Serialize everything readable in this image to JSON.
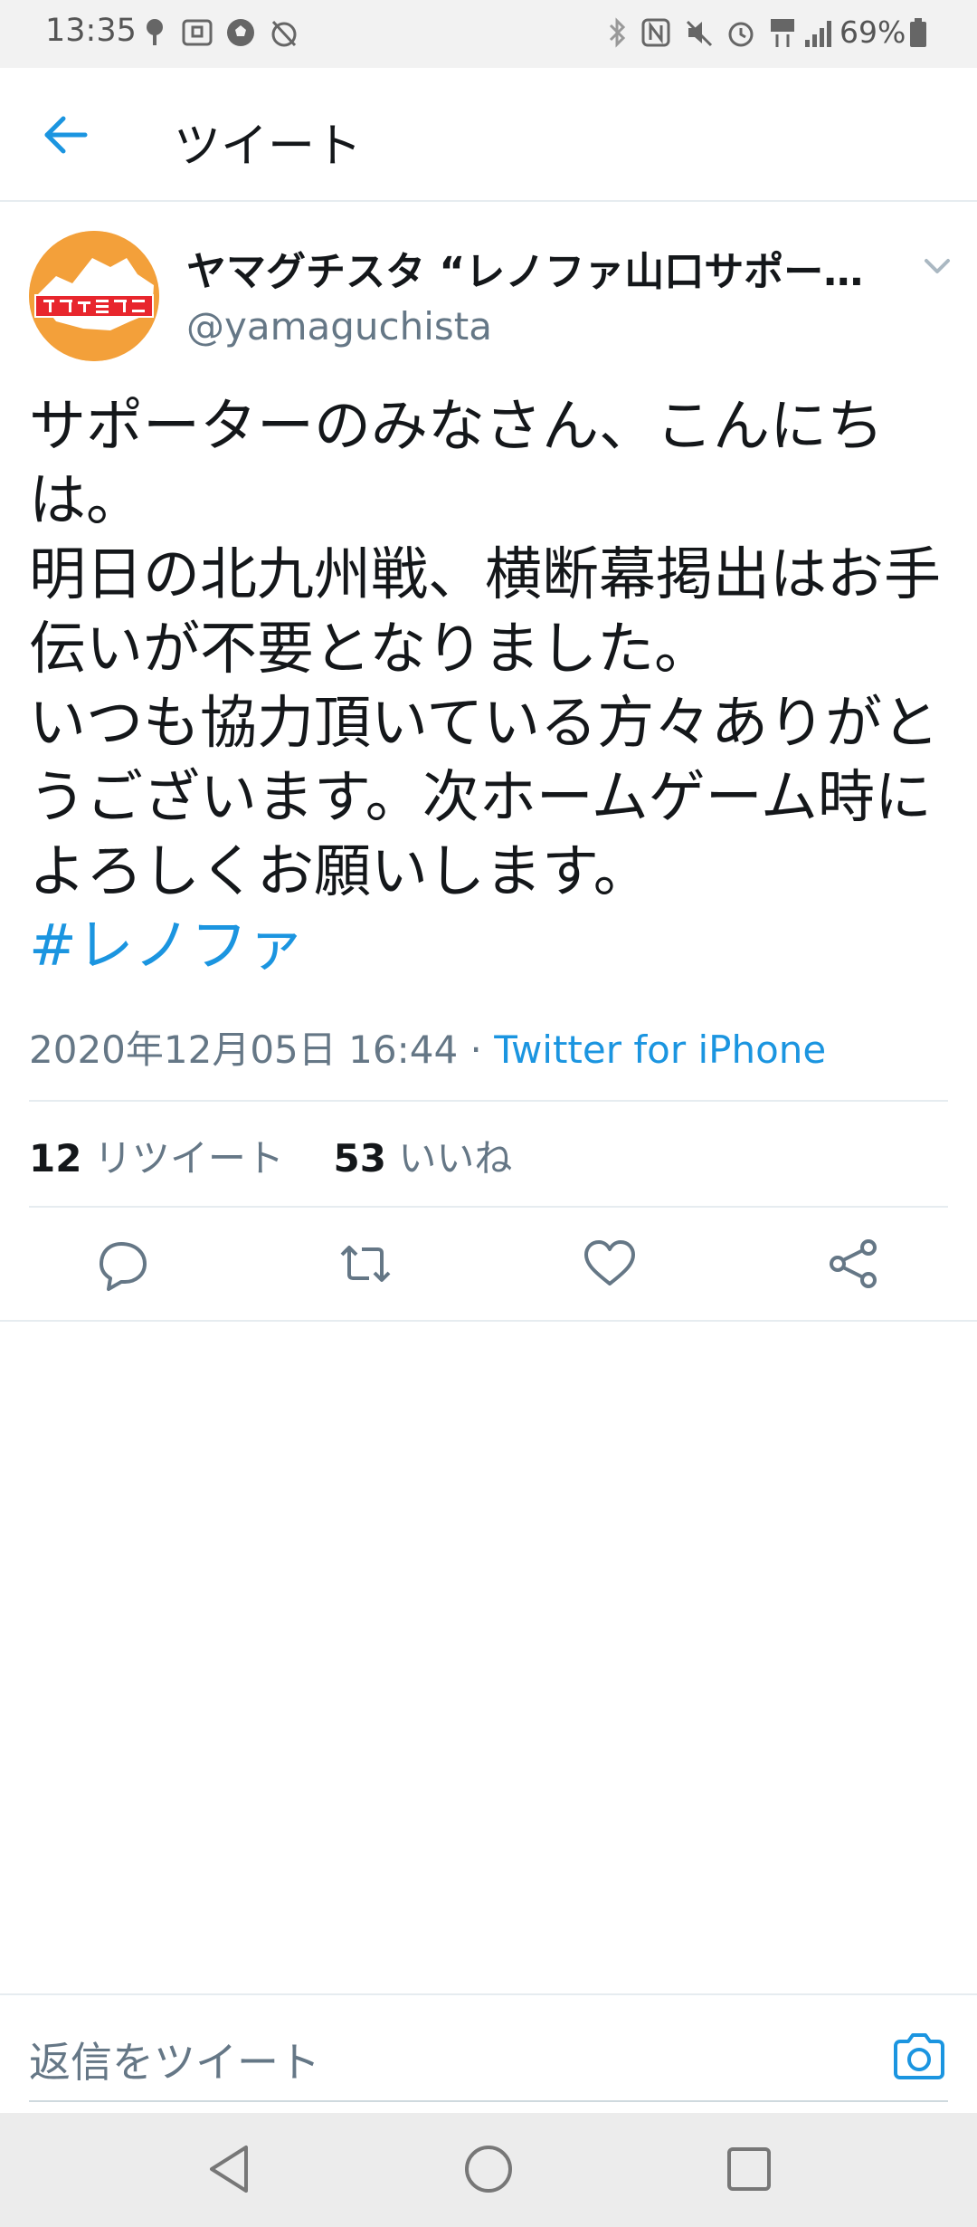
{
  "status_bar": {
    "time": "13:35",
    "battery": "69%"
  },
  "header": {
    "title": "ツイート"
  },
  "tweet": {
    "author_name": "ヤマグチスタ “レノファ山口サポー…",
    "handle": "@yamaguchista",
    "text": "サポーターのみなさん、こんにちは。\n明日の北九州戦、横断幕掲出はお手伝いが不要となりました。\nいつも協力頂いている方々ありがとうございます。次ホームゲーム時によろしくお願いします。",
    "hashtag": "#レノファ",
    "datetime": "2020年12月05日 16:44",
    "separator": " · ",
    "source": "Twitter for iPhone",
    "retweets_count": "12",
    "retweets_label": "リツイート",
    "likes_count": "53",
    "likes_label": "いいね"
  },
  "reply_bar": {
    "placeholder": "返信をツイート"
  },
  "colors": {
    "accent": "#1b95e0",
    "avatar_bg": "#f3a03a",
    "secondary_text": "#657786"
  }
}
